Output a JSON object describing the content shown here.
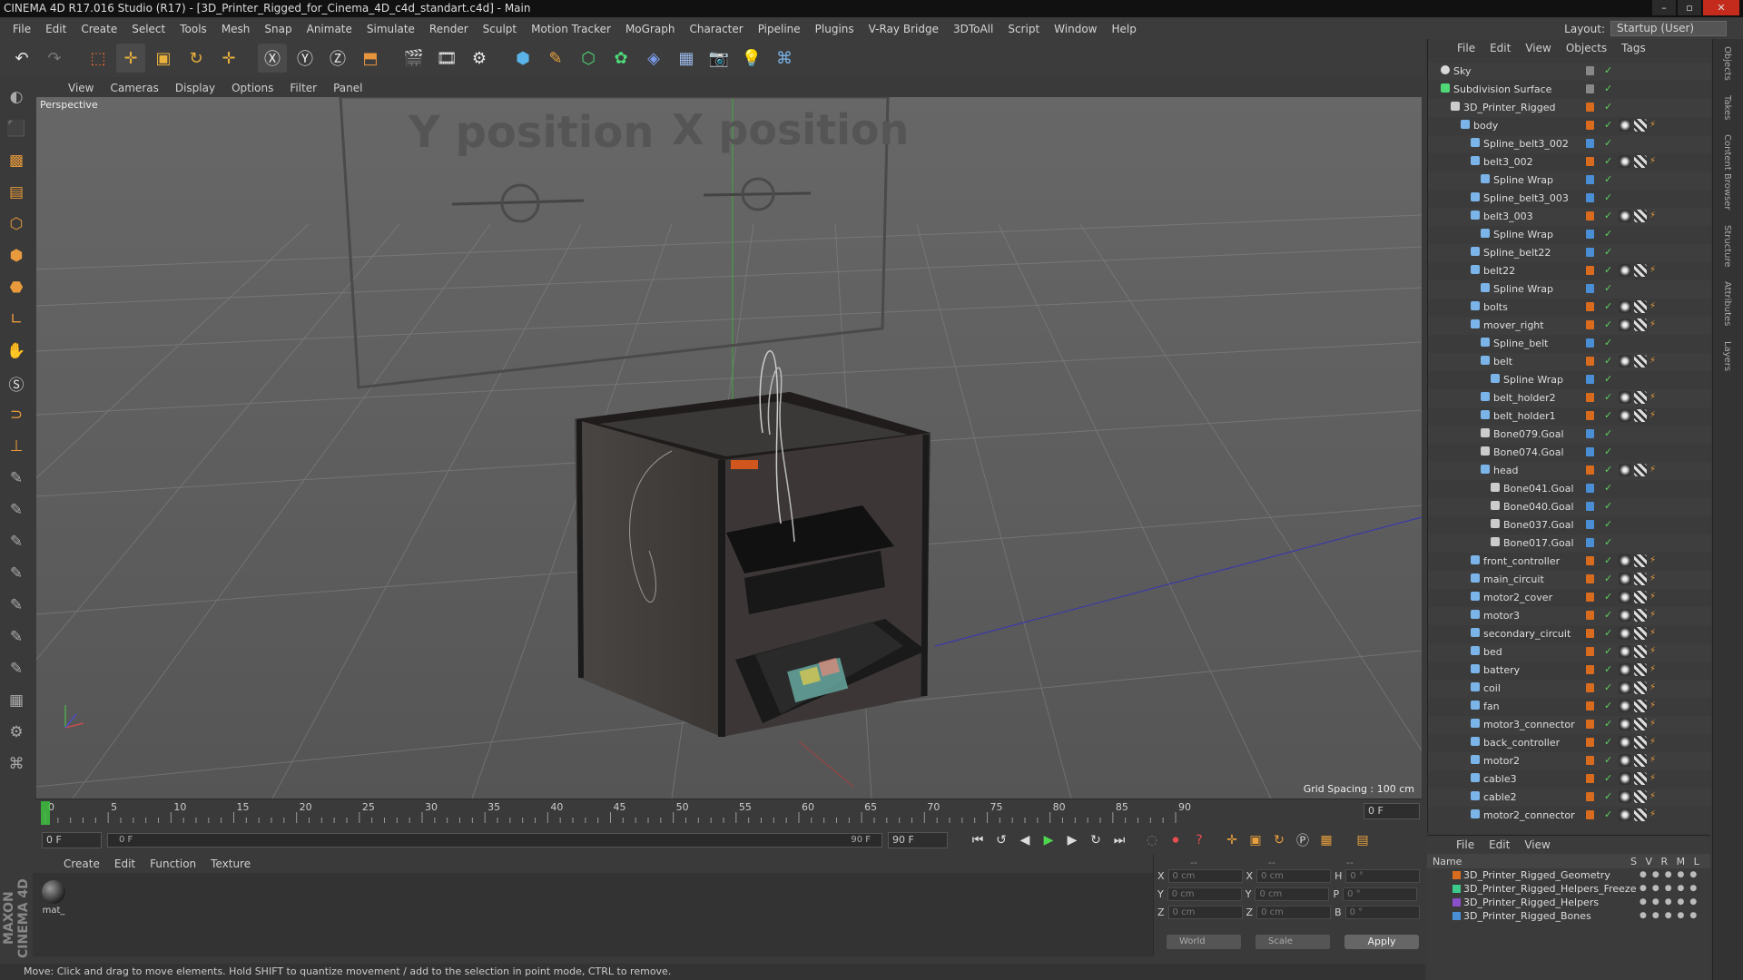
{
  "window": {
    "title": "CINEMA 4D R17.016 Studio (R17) - [3D_Printer_Rigged_for_Cinema_4D_c4d_standart.c4d] - Main"
  },
  "menu": [
    "File",
    "Edit",
    "Create",
    "Select",
    "Tools",
    "Mesh",
    "Snap",
    "Animate",
    "Simulate",
    "Render",
    "Sculpt",
    "Motion Tracker",
    "MoGraph",
    "Character",
    "Pipeline",
    "Plugins",
    "V-Ray Bridge",
    "3DToAll",
    "Script",
    "Window",
    "Help"
  ],
  "layout": {
    "label": "Layout:",
    "value": "Startup (User)"
  },
  "viewport": {
    "menu": [
      "View",
      "Cameras",
      "Display",
      "Options",
      "Filter",
      "Panel"
    ],
    "label": "Perspective",
    "grid_spacing": "Grid Spacing : 100 cm",
    "billboard": {
      "y_label": "Y position",
      "x_label": "X position"
    }
  },
  "timeline": {
    "ticks": [
      "0",
      "5",
      "10",
      "15",
      "20",
      "25",
      "30",
      "35",
      "40",
      "45",
      "50",
      "55",
      "60",
      "65",
      "70",
      "75",
      "80",
      "85",
      "90"
    ],
    "current_frame": "0 F",
    "start_field": "0 F",
    "range_start": "0 F",
    "range_end": "90 F",
    "end_field": "90 F"
  },
  "material_panel": {
    "menu": [
      "Create",
      "Edit",
      "Function",
      "Texture"
    ],
    "materials": [
      {
        "name": "mat_"
      }
    ]
  },
  "coord_panel": {
    "headers": [
      "--",
      "--",
      "--"
    ],
    "rows": [
      {
        "a": "X",
        "av": "0 cm",
        "b": "X",
        "bv": "0 cm",
        "c": "H",
        "cv": "0 °"
      },
      {
        "a": "Y",
        "av": "0 cm",
        "b": "Y",
        "bv": "0 cm",
        "c": "P",
        "cv": "0 °"
      },
      {
        "a": "Z",
        "av": "0 cm",
        "b": "Z",
        "bv": "0 cm",
        "c": "B",
        "cv": "0 °"
      }
    ],
    "mode": "World",
    "scale": "Scale",
    "apply": "Apply"
  },
  "status": "Move: Click and drag to move elements. Hold SHIFT to quantize movement / add to the selection in point mode, CTRL to remove.",
  "object_manager": {
    "menu": [
      "File",
      "Edit",
      "View",
      "Objects",
      "Tags"
    ],
    "objects": [
      {
        "name": "Sky",
        "depth": 0,
        "color": "#888888",
        "kind": "sky",
        "tags": ""
      },
      {
        "name": "Subdivision Surface",
        "depth": 0,
        "color": "#888888",
        "kind": "gen",
        "tags": ""
      },
      {
        "name": "3D_Printer_Rigged",
        "depth": 1,
        "color": "#d96b1e",
        "kind": "null",
        "tags": ""
      },
      {
        "name": "body",
        "depth": 2,
        "color": "#d96b1e",
        "kind": "joint",
        "tags": "t"
      },
      {
        "name": "Spline_belt3_002",
        "depth": 3,
        "color": "#4a8fd6",
        "kind": "spline",
        "tags": ""
      },
      {
        "name": "belt3_002",
        "depth": 3,
        "color": "#d96b1e",
        "kind": "joint",
        "tags": "t"
      },
      {
        "name": "Spline Wrap",
        "depth": 4,
        "color": "#4a8fd6",
        "kind": "spline",
        "tags": ""
      },
      {
        "name": "Spline_belt3_003",
        "depth": 3,
        "color": "#4a8fd6",
        "kind": "spline",
        "tags": ""
      },
      {
        "name": "belt3_003",
        "depth": 3,
        "color": "#d96b1e",
        "kind": "joint",
        "tags": "t"
      },
      {
        "name": "Spline Wrap",
        "depth": 4,
        "color": "#4a8fd6",
        "kind": "spline",
        "tags": ""
      },
      {
        "name": "Spline_belt22",
        "depth": 3,
        "color": "#4a8fd6",
        "kind": "spline",
        "tags": ""
      },
      {
        "name": "belt22",
        "depth": 3,
        "color": "#d96b1e",
        "kind": "joint",
        "tags": "t"
      },
      {
        "name": "Spline Wrap",
        "depth": 4,
        "color": "#4a8fd6",
        "kind": "spline",
        "tags": ""
      },
      {
        "name": "bolts",
        "depth": 3,
        "color": "#d96b1e",
        "kind": "joint",
        "tags": "t"
      },
      {
        "name": "mover_right",
        "depth": 3,
        "color": "#d96b1e",
        "kind": "joint",
        "tags": "t"
      },
      {
        "name": "Spline_belt",
        "depth": 4,
        "color": "#4a8fd6",
        "kind": "spline",
        "tags": ""
      },
      {
        "name": "belt",
        "depth": 4,
        "color": "#d96b1e",
        "kind": "joint",
        "tags": "t"
      },
      {
        "name": "Spline Wrap",
        "depth": 5,
        "color": "#4a8fd6",
        "kind": "spline",
        "tags": ""
      },
      {
        "name": "belt_holder2",
        "depth": 4,
        "color": "#d96b1e",
        "kind": "joint",
        "tags": "t"
      },
      {
        "name": "belt_holder1",
        "depth": 4,
        "color": "#d96b1e",
        "kind": "joint",
        "tags": "t"
      },
      {
        "name": "Bone079.Goal",
        "depth": 4,
        "color": "#4a8fd6",
        "kind": "null",
        "tags": ""
      },
      {
        "name": "Bone074.Goal",
        "depth": 4,
        "color": "#4a8fd6",
        "kind": "null",
        "tags": ""
      },
      {
        "name": "head",
        "depth": 4,
        "color": "#d96b1e",
        "kind": "joint",
        "tags": "t"
      },
      {
        "name": "Bone041.Goal",
        "depth": 5,
        "color": "#4a8fd6",
        "kind": "null",
        "tags": ""
      },
      {
        "name": "Bone040.Goal",
        "depth": 5,
        "color": "#4a8fd6",
        "kind": "null",
        "tags": ""
      },
      {
        "name": "Bone037.Goal",
        "depth": 5,
        "color": "#4a8fd6",
        "kind": "null",
        "tags": ""
      },
      {
        "name": "Bone017.Goal",
        "depth": 5,
        "color": "#4a8fd6",
        "kind": "null",
        "tags": ""
      },
      {
        "name": "front_controller",
        "depth": 3,
        "color": "#d96b1e",
        "kind": "joint",
        "tags": "t"
      },
      {
        "name": "main_circuit",
        "depth": 3,
        "color": "#d96b1e",
        "kind": "joint",
        "tags": "t"
      },
      {
        "name": "motor2_cover",
        "depth": 3,
        "color": "#d96b1e",
        "kind": "joint",
        "tags": "t"
      },
      {
        "name": "motor3",
        "depth": 3,
        "color": "#d96b1e",
        "kind": "joint",
        "tags": "t"
      },
      {
        "name": "secondary_circuit",
        "depth": 3,
        "color": "#d96b1e",
        "kind": "joint",
        "tags": "t"
      },
      {
        "name": "bed",
        "depth": 3,
        "color": "#d96b1e",
        "kind": "joint",
        "tags": "t"
      },
      {
        "name": "battery",
        "depth": 3,
        "color": "#d96b1e",
        "kind": "joint",
        "tags": "t"
      },
      {
        "name": "coil",
        "depth": 3,
        "color": "#d96b1e",
        "kind": "joint",
        "tags": "t"
      },
      {
        "name": "fan",
        "depth": 3,
        "color": "#d96b1e",
        "kind": "joint",
        "tags": "t"
      },
      {
        "name": "motor3_connector",
        "depth": 3,
        "color": "#d96b1e",
        "kind": "joint",
        "tags": "t"
      },
      {
        "name": "back_controller",
        "depth": 3,
        "color": "#d96b1e",
        "kind": "joint",
        "tags": "t"
      },
      {
        "name": "motor2",
        "depth": 3,
        "color": "#d96b1e",
        "kind": "joint",
        "tags": "t"
      },
      {
        "name": "cable3",
        "depth": 3,
        "color": "#d96b1e",
        "kind": "joint",
        "tags": "t"
      },
      {
        "name": "cable2",
        "depth": 3,
        "color": "#d96b1e",
        "kind": "joint",
        "tags": "t"
      },
      {
        "name": "motor2_connector",
        "depth": 3,
        "color": "#d96b1e",
        "kind": "joint",
        "tags": "t"
      }
    ]
  },
  "layer_manager": {
    "menu": [
      "File",
      "Edit",
      "View"
    ],
    "header": {
      "name": "Name",
      "cols": "S V R M L"
    },
    "layers": [
      {
        "name": "3D_Printer_Rigged_Geometry",
        "color": "#d96b1e"
      },
      {
        "name": "3D_Printer_Rigged_Helpers_Freeze",
        "color": "#3cc98a"
      },
      {
        "name": "3D_Printer_Rigged_Helpers",
        "color": "#8a4fc9"
      },
      {
        "name": "3D_Printer_Rigged_Bones",
        "color": "#4a8fd6"
      }
    ]
  },
  "right_tabs": [
    "Objects",
    "Takes",
    "Content Browser",
    "Structure",
    "Attributes",
    "Layers"
  ]
}
